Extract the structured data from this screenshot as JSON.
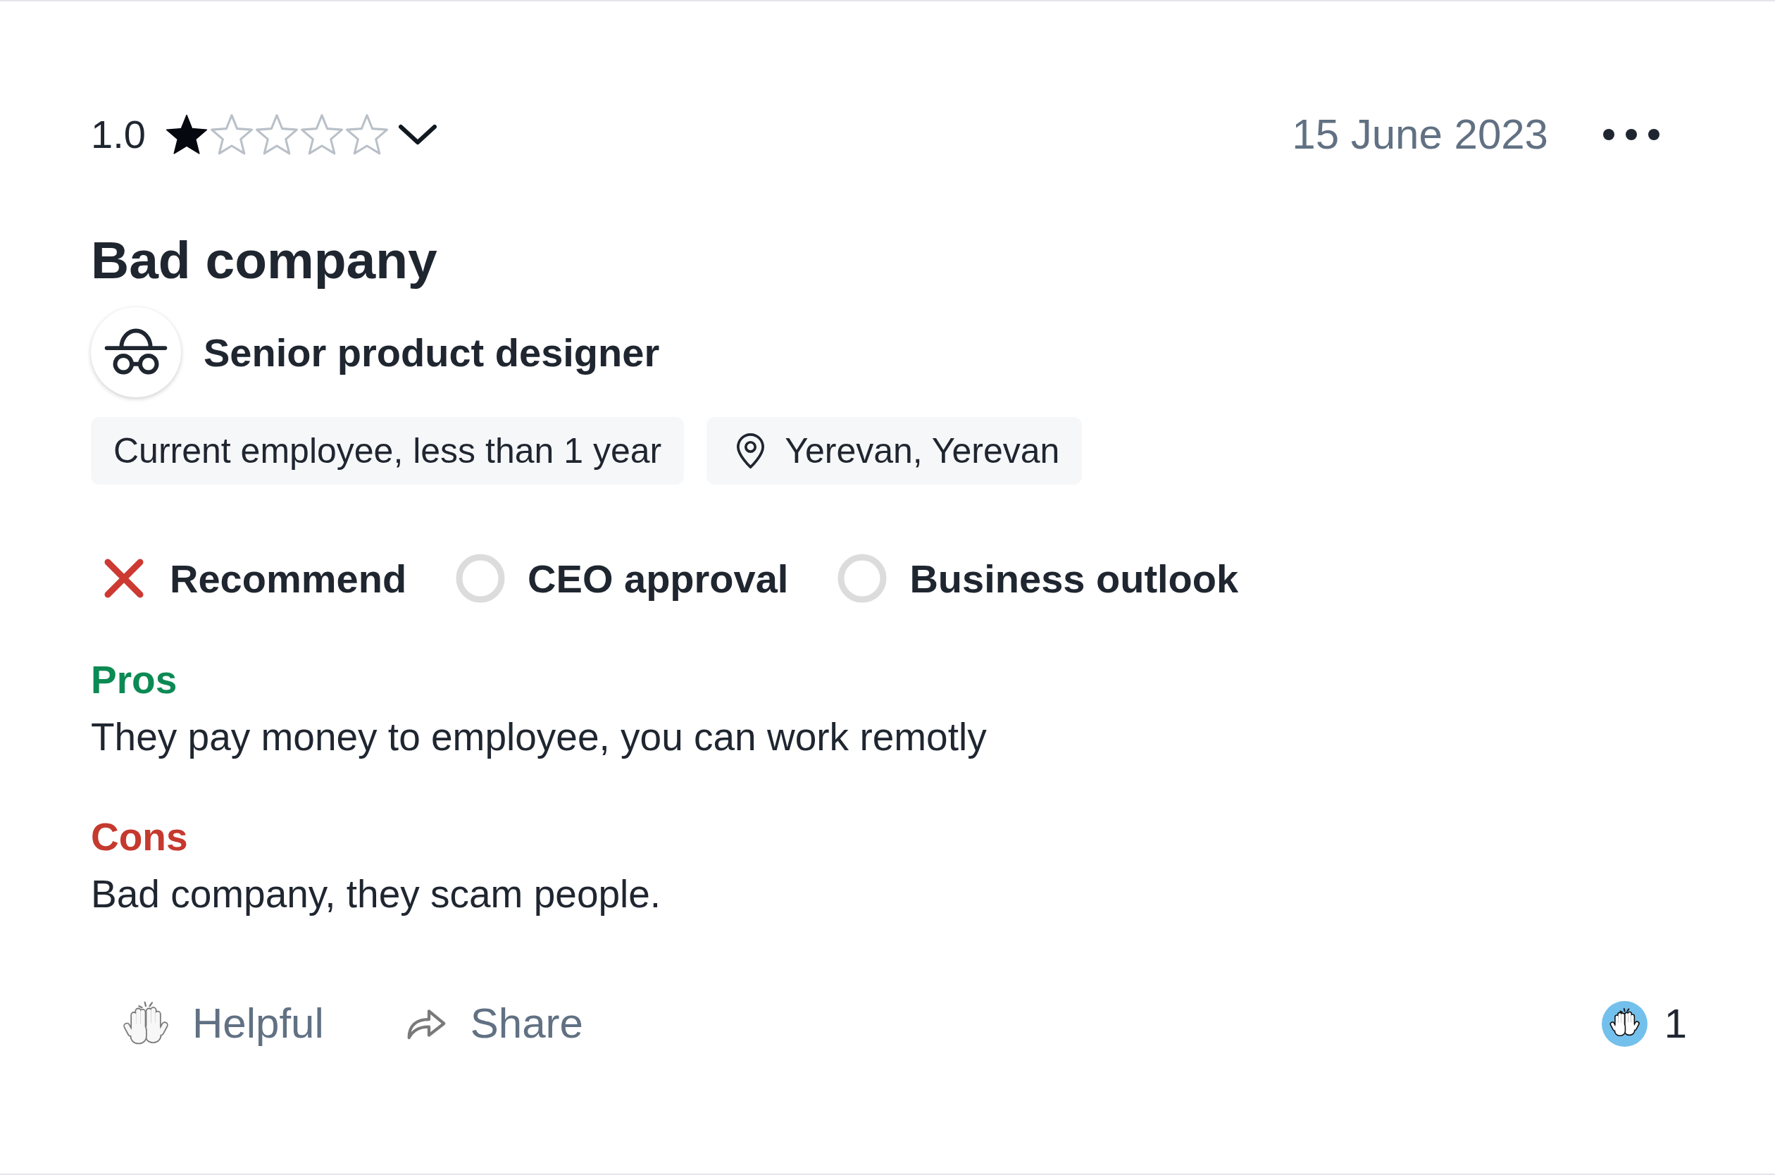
{
  "review": {
    "rating": {
      "value": "1.0",
      "stars": 1
    },
    "date": "15 June 2023",
    "title": "Bad company",
    "job_title": "Senior product designer",
    "tags": [
      {
        "kind": "employment",
        "label": "Current employee, less than 1 year"
      },
      {
        "kind": "location",
        "label": "Yerevan, Yerevan"
      }
    ],
    "indicators": [
      {
        "kind": "negative",
        "label": "Recommend"
      },
      {
        "kind": "unrated",
        "label": "CEO approval"
      },
      {
        "kind": "unrated",
        "label": "Business outlook"
      }
    ],
    "sections": [
      {
        "kind": "pros",
        "heading": "Pros",
        "text": "They pay money to employee, you can work remotly"
      },
      {
        "kind": "cons",
        "heading": "Cons",
        "text": "Bad company, they scam people."
      }
    ],
    "actions": [
      {
        "kind": "helpful",
        "label": "Helpful"
      },
      {
        "kind": "share",
        "label": "Share"
      }
    ],
    "helpful_count": "1"
  }
}
